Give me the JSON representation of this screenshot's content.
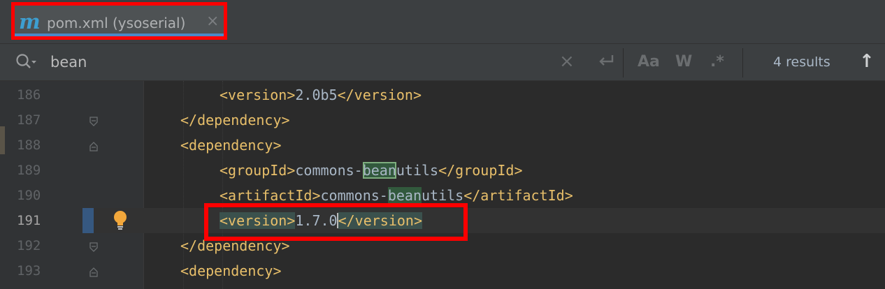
{
  "tab": {
    "icon": "maven-m-icon",
    "icon_glyph": "m",
    "label": "pom.xml (ysoserial)",
    "close_glyph": "×"
  },
  "search": {
    "query": "bean",
    "results": "4 results",
    "match_case": "Aa",
    "words": "W",
    "regex": ".*",
    "clear_glyph": "×",
    "up_glyph": "↑"
  },
  "lines": [
    {
      "num": "186",
      "tag_open": "<version>",
      "text": "2.0b5",
      "tag_close": "</version>"
    },
    {
      "num": "187",
      "tag_open": "</dependency>"
    },
    {
      "num": "188",
      "tag_open": "<dependency>"
    },
    {
      "num": "189",
      "tag_open": "<groupId>",
      "pre": "commons-",
      "match": "bean",
      "post": "utils",
      "tag_close": "</groupId>"
    },
    {
      "num": "190",
      "tag_open": "<artifactId>",
      "pre": "commons-",
      "match": "bean",
      "post": "utils",
      "tag_close": "</artifactId>"
    },
    {
      "num": "191",
      "tag_open": "<version>",
      "text_a": "1.7.0",
      "tag_close": "</version>"
    },
    {
      "num": "192",
      "tag_open": "</dependency>"
    },
    {
      "num": "193",
      "tag_open": "<dependency>"
    }
  ],
  "colors": {
    "tag": "#e8bf6a",
    "text": "#a9b7c6",
    "highlight": "#ff0000",
    "accent": "#4a88c7"
  }
}
